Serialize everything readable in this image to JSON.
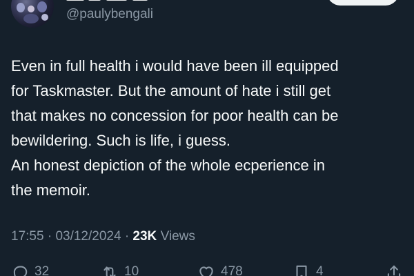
{
  "tweet": {
    "handle": "@paulybengali",
    "text_lines": [
      "Even in full health i would have been ill equipped",
      "for Taskmaster. But the amount of hate i still get",
      "that makes no concession for poor health can be",
      "bewildering. Such is life, i guess.",
      "An honest depiction of the whole ecperience in",
      "the memoir."
    ],
    "time": "17:55",
    "separator": "·",
    "date": "03/12/2024",
    "views_count": "23K",
    "views_label": "Views"
  },
  "actions": {
    "replies": {
      "icon": "reply-icon",
      "count": "32"
    },
    "reposts": {
      "icon": "repost-icon",
      "count": "10"
    },
    "likes": {
      "icon": "like-icon",
      "count": "478"
    },
    "bookmarks": {
      "icon": "bookmark-icon",
      "count": "4"
    },
    "share": {
      "icon": "share-icon"
    }
  },
  "colors": {
    "background": "#15202b",
    "text": "#f7f9f9",
    "secondary_text": "#8b98a5",
    "button": "#eff3f4"
  }
}
